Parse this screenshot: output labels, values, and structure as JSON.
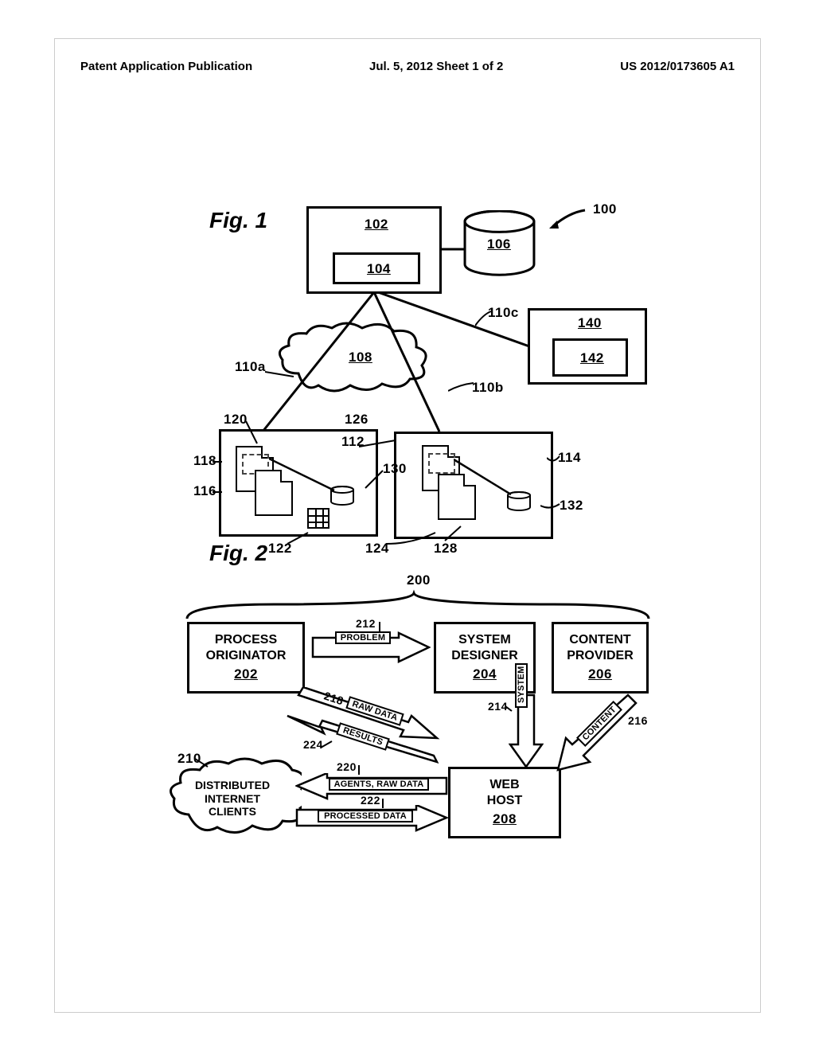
{
  "header": {
    "left": "Patent Application Publication",
    "center": "Jul. 5, 2012  Sheet 1 of 2",
    "right": "US 2012/0173605 A1"
  },
  "fig1": {
    "title": "Fig. 1",
    "refs": {
      "r100": "100",
      "r102": "102",
      "r104": "104",
      "r106": "106",
      "r108": "108",
      "r110a": "110a",
      "r110b": "110b",
      "r110c": "110c",
      "r112": "112",
      "r114": "114",
      "r116": "116",
      "r118": "118",
      "r120": "120",
      "r122": "122",
      "r124": "124",
      "r126": "126",
      "r128": "128",
      "r130": "130",
      "r132": "132",
      "r140": "140",
      "r142": "142"
    }
  },
  "fig2": {
    "title": "Fig. 2",
    "refs": {
      "r200": "200",
      "r202": "202",
      "r204": "204",
      "r206": "206",
      "r208": "208",
      "r210": "210",
      "r212": "212",
      "r214": "214",
      "r216": "216",
      "r218": "218",
      "r220": "220",
      "r222": "222",
      "r224": "224"
    },
    "boxes": {
      "process_originator_l1": "PROCESS",
      "process_originator_l2": "ORIGINATOR",
      "system_designer_l1": "SYSTEM",
      "system_designer_l2": "DESIGNER",
      "content_provider_l1": "CONTENT",
      "content_provider_l2": "PROVIDER",
      "web_host_l1": "WEB",
      "web_host_l2": "HOST",
      "clients_cloud_l1": "DISTRIBUTED",
      "clients_cloud_l2": "INTERNET",
      "clients_cloud_l3": "CLIENTS"
    },
    "arrows": {
      "problem": "PROBLEM",
      "raw_data": "RAW DATA",
      "results": "RESULTS",
      "system": "SYSTEM",
      "content": "CONTENT",
      "agents_raw": "AGENTS, RAW DATA",
      "processed": "PROCESSED DATA"
    }
  }
}
